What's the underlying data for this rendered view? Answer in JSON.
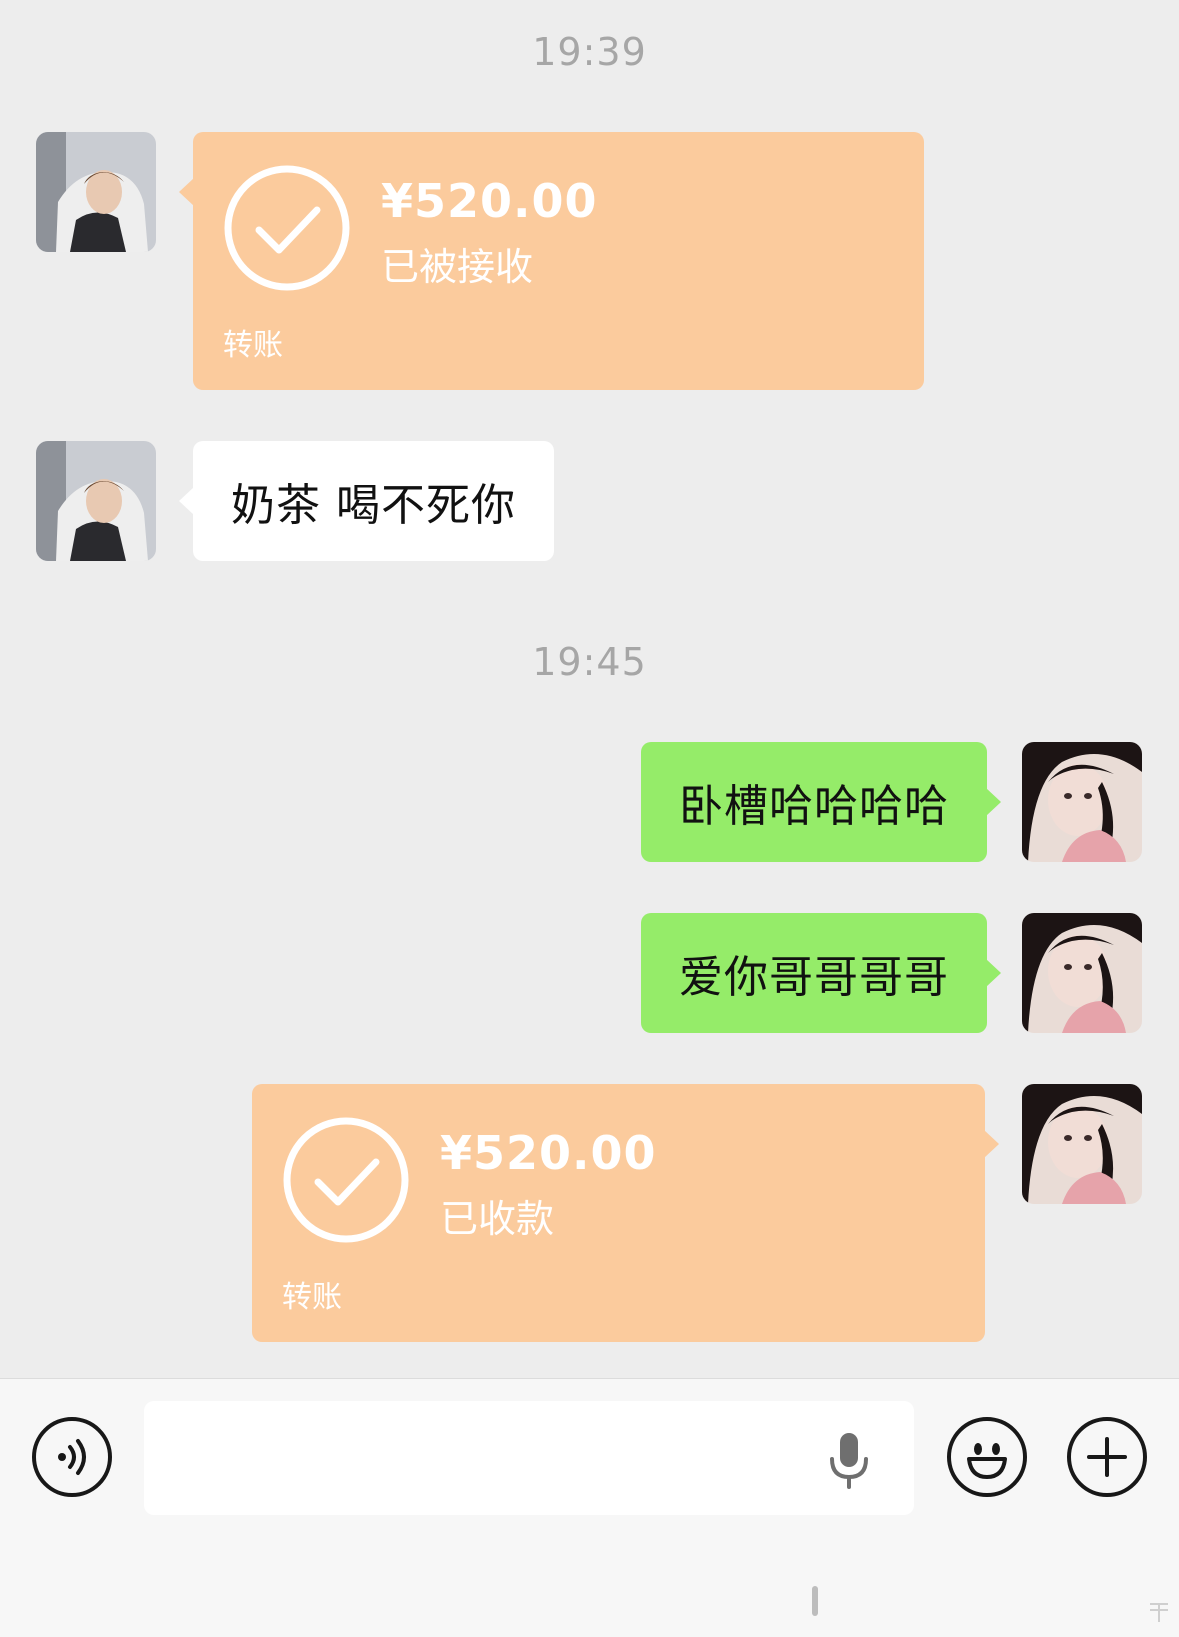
{
  "messages": [
    {
      "time": "19:39"
    },
    {
      "transfer_received": {
        "amount": "¥520.00",
        "status": "已被接收",
        "label": "转账"
      }
    },
    {
      "text_left": "奶茶 喝不死你"
    },
    {
      "time2": "19:45"
    },
    {
      "text_right_1": "卧槽哈哈哈哈"
    },
    {
      "text_right_2": "爱你哥哥哥哥"
    },
    {
      "transfer_sent": {
        "amount": "¥520.00",
        "status": "已收款",
        "label": "转账"
      }
    }
  ],
  "chat": {
    "time_1": "19:39",
    "time_2": "19:45",
    "incoming_transfer": {
      "amount": "¥520.00",
      "status": "已被接收",
      "label": "转账"
    },
    "incoming_text": "奶茶 喝不死你",
    "outgoing_text_1": "卧槽哈哈哈哈",
    "outgoing_text_2": "爱你哥哥哥哥",
    "outgoing_transfer": {
      "amount": "¥520.00",
      "status": "已收款",
      "label": "转账"
    }
  },
  "input_bar": {
    "input_value": "",
    "icons": [
      "voice-icon",
      "microphone-icon",
      "emoji-icon",
      "plus-icon"
    ]
  },
  "colors": {
    "background": "#ededed",
    "transfer_bubble": "#fbcb9d",
    "own_bubble": "#95ec69",
    "other_bubble": "#ffffff",
    "timestamp": "#a6a6a6"
  }
}
